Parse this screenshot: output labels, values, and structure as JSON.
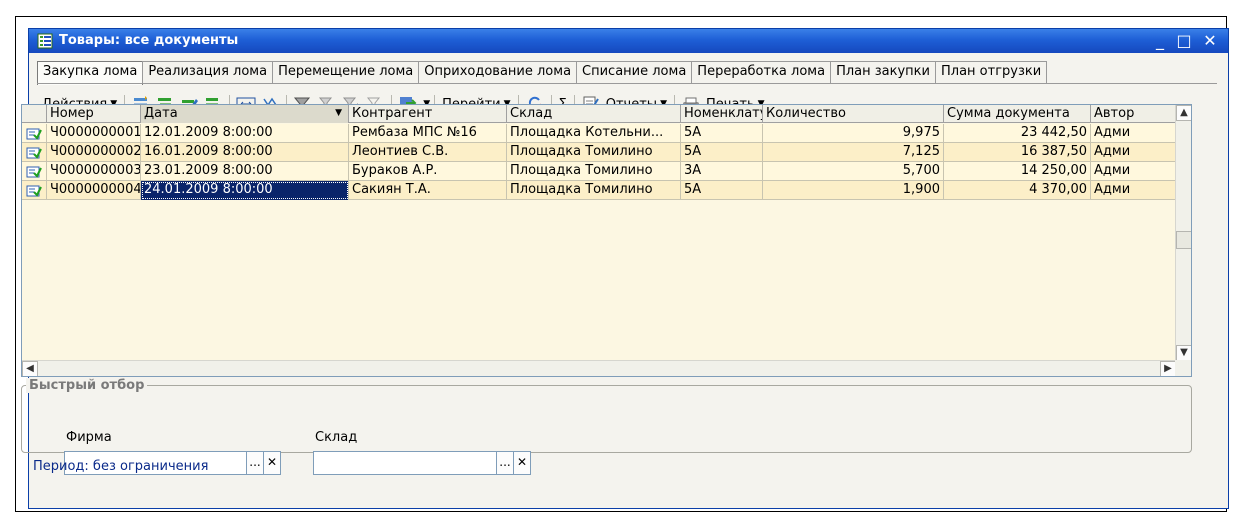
{
  "window": {
    "title": "Товары: все документы",
    "minimize": "_",
    "maximize": "□",
    "close": "✕"
  },
  "tabs": [
    "Закупка лома",
    "Реализация лома",
    "Перемещение лома",
    "Оприходование лома",
    "Списание лома",
    "Переработка лома",
    "План закупки",
    "План отгрузки"
  ],
  "active_tab": "Закупка лома",
  "toolbar": {
    "actions_label": "Действия",
    "goto_label": "Перейти",
    "sum_symbol": "Σ",
    "reports_label": "Отчеты",
    "print_label": "Печать"
  },
  "grid": {
    "columns": [
      "Номер",
      "Дата",
      "Контрагент",
      "Склад",
      "Номенклату...",
      "Количество",
      "Сумма документа",
      "Автор"
    ],
    "sorted_column": "Дата",
    "rows": [
      {
        "number": "Ч0000000001",
        "date": "12.01.2009 8:00:00",
        "counterparty": "Рембаза МПС №16",
        "warehouse": "Площадка Котельни...",
        "nomenclature": "5А",
        "quantity": "9,975",
        "amount": "23 442,50",
        "author": "Адми"
      },
      {
        "number": "Ч0000000002",
        "date": "16.01.2009 8:00:00",
        "counterparty": "Леонтиев С.В.",
        "warehouse": "Площадка Томилино",
        "nomenclature": "5А",
        "quantity": "7,125",
        "amount": "16 387,50",
        "author": "Адми"
      },
      {
        "number": "Ч0000000003",
        "date": "23.01.2009 8:00:00",
        "counterparty": "Бураков А.Р.",
        "warehouse": "Площадка Томилино",
        "nomenclature": "3А",
        "quantity": "5,700",
        "amount": "14 250,00",
        "author": "Адми"
      },
      {
        "number": "Ч0000000004",
        "date": "24.01.2009 8:00:00",
        "counterparty": "Сакиян Т.А.",
        "warehouse": "Площадка Томилино",
        "nomenclature": "5А",
        "quantity": "1,900",
        "amount": "4 370,00",
        "author": "Адми"
      }
    ]
  },
  "quick_filter": {
    "title": "Быстрый отбор",
    "firm_label": "Фирма",
    "firm_value": "",
    "warehouse_label": "Склад",
    "warehouse_value": "",
    "select_symbol": "...",
    "clear_symbol": "✕"
  },
  "status": {
    "period": "Период: без ограничения"
  },
  "colors": {
    "title_bar": "#1e5fd6",
    "row_bg": "#fff8dd",
    "row_alt_bg": "#fcefc8",
    "selection": "#0a246a",
    "period_text": "#0a2a8a"
  }
}
